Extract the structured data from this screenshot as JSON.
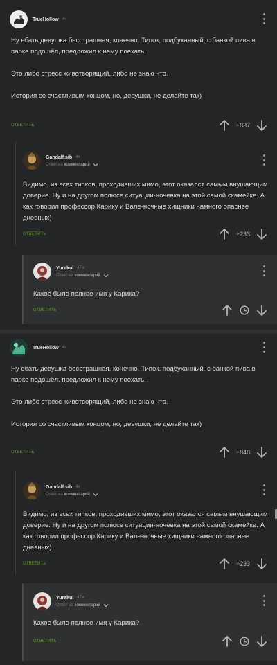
{
  "threads": [
    {
      "root": {
        "author": "TrueHollow",
        "time": "4ч",
        "paragraphs": [
          "Ну ебать девушка бесстрашная, конечно. Типок, подбуханный, с банкой пива в парке подошёл, предложил к нему поехать.",
          "Это либо стресс животворящий, либо не знаю что.",
          "История со счастливым концом, но, девушки, не делайте так)"
        ],
        "reply_label": "ОТВЕТИТЬ",
        "votes": "+837"
      },
      "reply1": {
        "author": "Gandalf.sib",
        "time": "4ч",
        "reply_to_prefix": "Ответ на",
        "reply_to_link": "комментарий",
        "paragraphs": [
          "Видимо, из всех типков, проходивших мимо, этот оказался самым внушающим доверие. Ну и на другом полюсе ситуации-ночевка на этой самой скамейке. А как говорил профессор Карику и Вале-ночные хищники намного опаснее дневных)"
        ],
        "reply_label": "ОТВЕТИТЬ",
        "votes": "+233"
      },
      "reply2": {
        "author": "Yurakul",
        "time": "47м",
        "reply_to_prefix": "Ответ на",
        "reply_to_link": "комментарий",
        "paragraphs": [
          "Какое было полное имя у Карика?"
        ],
        "reply_label": "ОТВЕТИТЬ"
      }
    },
    {
      "root": {
        "author": "TrueHollow",
        "time": "4ч",
        "paragraphs": [
          "Ну ебать девушка бесстрашная, конечно. Типок, подбуханный, с банкой пива в парке подошёл, предложил к нему поехать.",
          "Это либо стресс животворящий, либо не знаю что.",
          "История со счастливым концом, но, девушки, не делайте так)"
        ],
        "reply_label": "ОТВЕТИТЬ",
        "votes": "+848"
      },
      "reply1": {
        "author": "Gandalf.sib",
        "time": "4ч",
        "reply_to_prefix": "Ответ на",
        "reply_to_link": "комментарий",
        "paragraphs": [
          "Видимо, из всех типков, проходивших мимо, этот оказался самым внушающим доверие. Ну и на другом полюсе ситуации-ночевка на этой самой скамейке. А как говорил профессор Карику и Вале-ночные хищники намного опаснее дневных)"
        ],
        "reply_label": "ОТВЕТИТЬ",
        "votes": "+233"
      },
      "reply2": {
        "author": "Yurakul",
        "time": "47м",
        "reply_to_prefix": "Ответ на",
        "reply_to_link": "комментарий",
        "paragraphs": [
          "Какое было полное имя у Карика?"
        ],
        "reply_label": "ОТВЕТИТЬ"
      }
    }
  ],
  "colors": {
    "background": "#242526",
    "nested_background": "#2f3032",
    "reply_green": "#5f9a2e",
    "text": "#dcdcdc"
  },
  "icons": [
    "more-vertical-icon",
    "arrow-up-icon",
    "arrow-down-icon",
    "clock-icon",
    "chevron-down-icon"
  ]
}
